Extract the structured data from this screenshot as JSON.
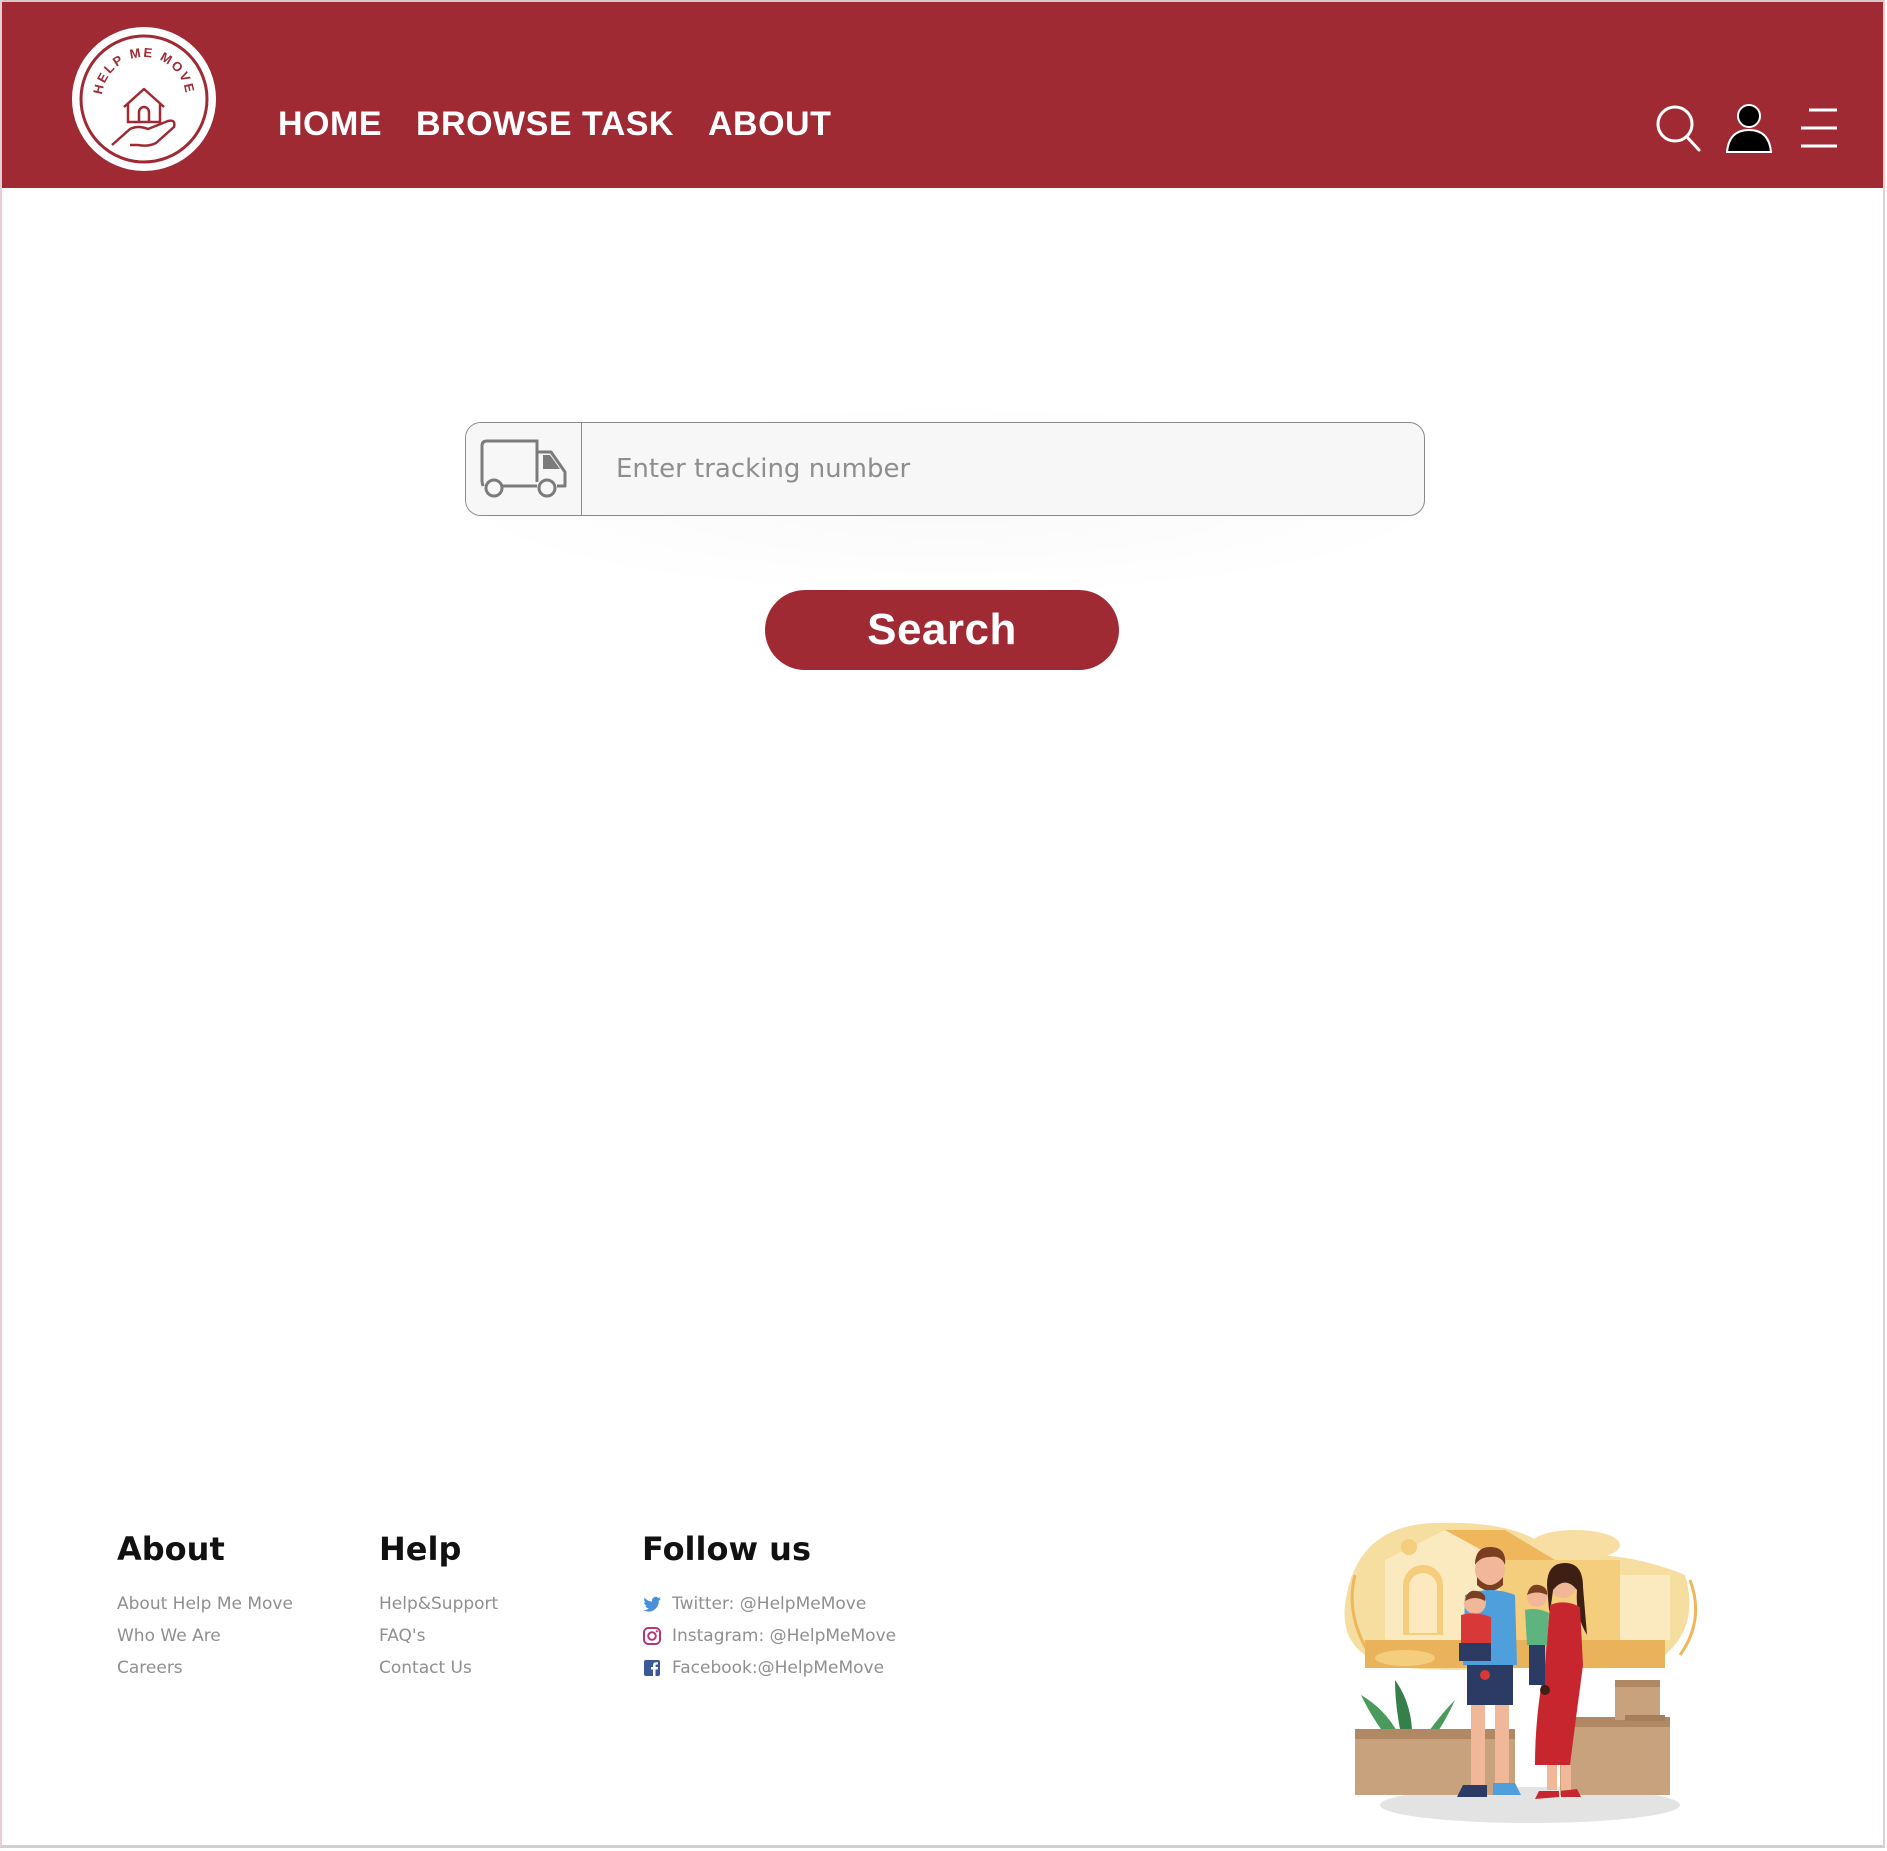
{
  "brand": {
    "name": "HELP ME MOVE",
    "primary_color": "#9f2a33"
  },
  "nav": {
    "items": [
      "HOME",
      "BROWSE TASK",
      "ABOUT"
    ]
  },
  "header_icons": [
    "search-icon",
    "user-icon",
    "menu-icon"
  ],
  "tracking": {
    "icon": "truck-icon",
    "placeholder": "Enter tracking number",
    "value": "",
    "search_label": "Search"
  },
  "footer": {
    "about": {
      "title": "About",
      "links": [
        "About Help Me Move",
        "Who We Are",
        "Careers"
      ]
    },
    "help": {
      "title": "Help",
      "links": [
        "Help&Support",
        "FAQ's",
        "Contact Us"
      ]
    },
    "follow": {
      "title": "Follow us",
      "links": [
        {
          "icon": "twitter-icon",
          "label": "Twitter: @HelpMeMove"
        },
        {
          "icon": "instagram-icon",
          "label": "Instagram: @HelpMeMove"
        },
        {
          "icon": "facebook-icon",
          "label": "Facebook:@HelpMeMove"
        }
      ]
    }
  }
}
